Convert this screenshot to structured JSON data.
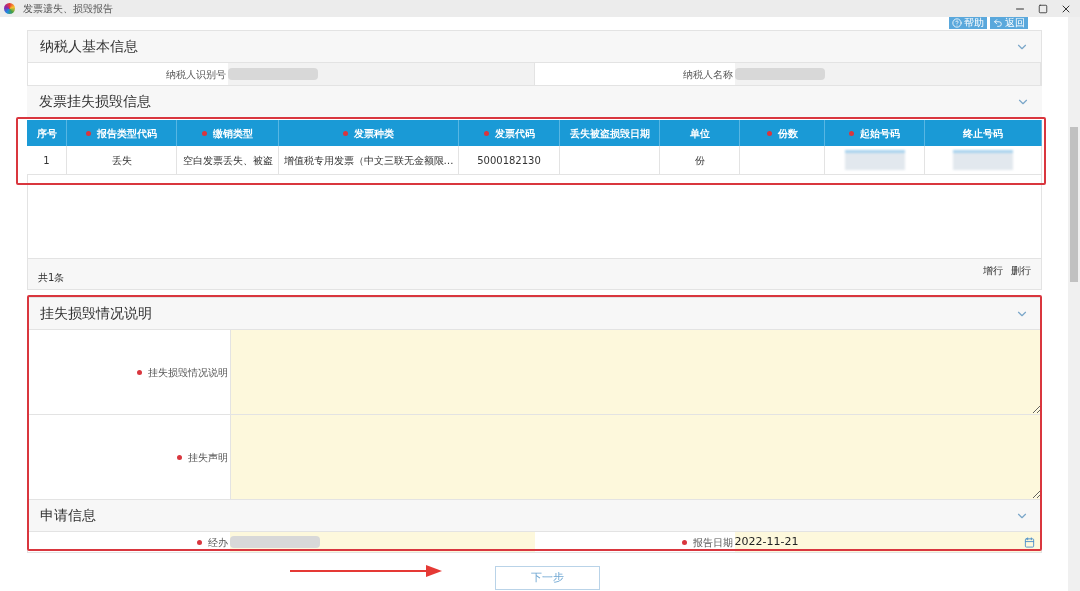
{
  "window": {
    "title": "发票遗失、损毁报告"
  },
  "toolbar": {
    "buttons": [
      "帮助",
      "返回"
    ]
  },
  "taxpayer_section": {
    "title": "纳税人基本信息",
    "expanded": true,
    "fields": [
      {
        "label": "纳税人识别号",
        "redacted": true
      },
      {
        "label": "纳税人名称",
        "redacted": true
      }
    ]
  },
  "invoice_section": {
    "title": "发票挂失损毁信息",
    "expanded": true,
    "table": {
      "columns": [
        {
          "label": "序号",
          "required": false
        },
        {
          "label": "报告类型代码",
          "required": true
        },
        {
          "label": "缴销类型",
          "required": true
        },
        {
          "label": "发票种类",
          "required": true
        },
        {
          "label": "发票代码",
          "required": true
        },
        {
          "label": "丢失被盗损毁日期",
          "required": false
        },
        {
          "label": "单位",
          "required": false
        },
        {
          "label": "份数",
          "required": true
        },
        {
          "label": "起始号码",
          "required": true
        },
        {
          "label": "终止号码",
          "required": false
        }
      ],
      "rows": [
        [
          {
            "kind": "text",
            "text": "1"
          },
          {
            "kind": "text",
            "text": "丢失"
          },
          {
            "kind": "text",
            "text": "空白发票丢失、被盗"
          },
          {
            "kind": "text",
            "text": "增值税专用发票（中文三联无金额限…"
          },
          {
            "kind": "text",
            "text": "5000182130"
          },
          {
            "kind": "empty"
          },
          {
            "kind": "text",
            "text": "份"
          },
          {
            "kind": "empty"
          },
          {
            "kind": "redacted"
          },
          {
            "kind": "redacted"
          }
        ]
      ]
    },
    "count": "共1条",
    "actions": [
      "增行",
      "删行"
    ]
  },
  "loss_section": {
    "title": "挂失损毁情况说明",
    "expanded": true,
    "fields": [
      {
        "label": "挂失损毁情况说明",
        "required": true
      },
      {
        "label": "挂失声明",
        "required": true
      }
    ]
  },
  "application_section": {
    "title": "申请信息",
    "expanded": true,
    "fields": [
      {
        "label": "经办",
        "required": true,
        "redacted": true
      },
      {
        "label": "报告日期",
        "required": true,
        "value": "2022-11-21"
      }
    ]
  },
  "next_button": "下一步"
}
